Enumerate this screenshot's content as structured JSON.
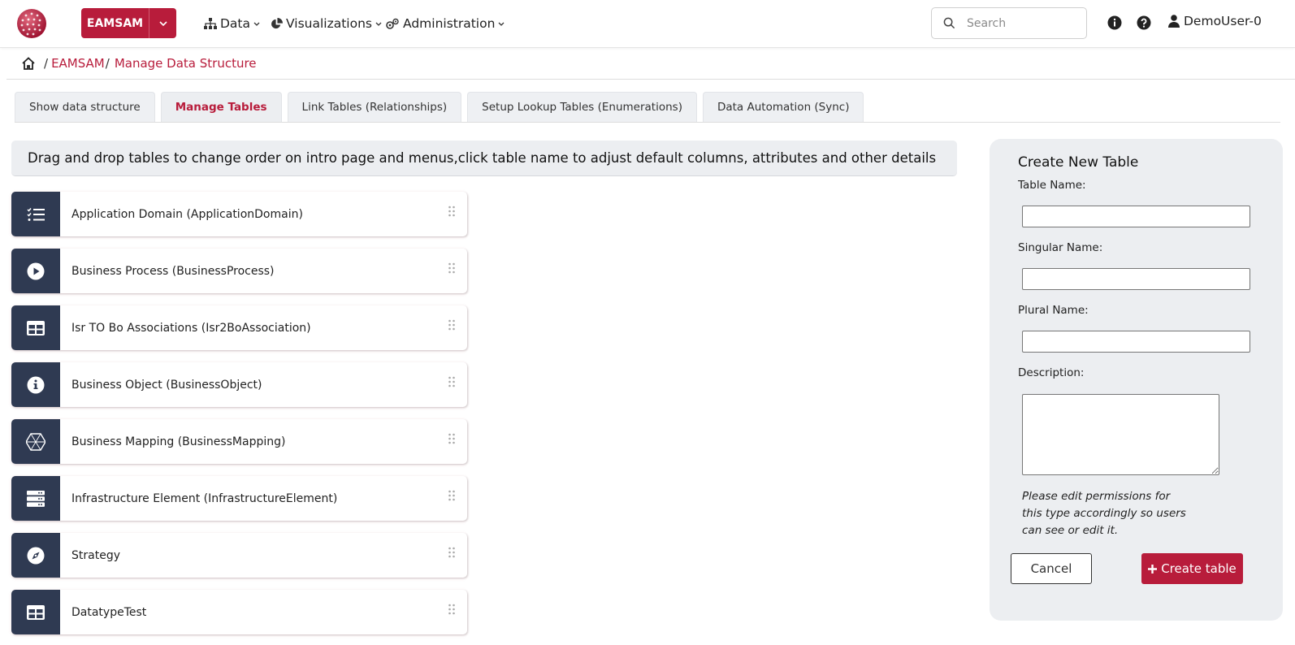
{
  "header": {
    "app_button_label": "EAMSAM",
    "menus": [
      {
        "label": "Data"
      },
      {
        "label": "Visualizations"
      },
      {
        "label": "Administration"
      }
    ],
    "search_placeholder": "Search",
    "user_name": "DemoUser-0"
  },
  "breadcrumb": {
    "items": [
      "EAMSAM",
      "Manage Data Structure"
    ]
  },
  "tabs": [
    {
      "label": "Show data structure",
      "active": false
    },
    {
      "label": "Manage Tables",
      "active": true
    },
    {
      "label": "Link Tables (Relationships)",
      "active": false
    },
    {
      "label": "Setup Lookup Tables (Enumerations)",
      "active": false
    },
    {
      "label": "Data Automation (Sync)",
      "active": false
    }
  ],
  "banner_text": "Drag and drop tables to change order on intro page and menus,click table name to adjust default columns, attributes and other details",
  "tables": [
    {
      "name": "Application Domain (ApplicationDomain)",
      "icon": "checklist-icon"
    },
    {
      "name": "Business Process (BusinessProcess)",
      "icon": "play-circle-icon"
    },
    {
      "name": "Isr TO Bo Associations (Isr2BoAssociation)",
      "icon": "table-grid-icon"
    },
    {
      "name": "Business Object (BusinessObject)",
      "icon": "info-circle-icon"
    },
    {
      "name": "Business Mapping (BusinessMapping)",
      "icon": "hexagon-network-icon"
    },
    {
      "name": "Infrastructure Element (InfrastructureElement)",
      "icon": "server-icon"
    },
    {
      "name": "Strategy",
      "icon": "compass-icon"
    },
    {
      "name": "DatatypeTest",
      "icon": "table-grid-icon"
    }
  ],
  "create_form": {
    "title": "Create New Table",
    "table_name_label": "Table Name:",
    "table_name_value": "",
    "singular_label": "Singular Name:",
    "singular_value": "",
    "plural_label": "Plural Name:",
    "plural_value": "",
    "description_label": "Description:",
    "description_value": "",
    "note": "Please edit permissions for this type accordingly so users can see or edit it.",
    "cancel_label": "Cancel",
    "create_label": "Create table"
  },
  "colors": {
    "brand": "#b81c3b",
    "icon_tile": "#2f3a52",
    "panel_bg": "#eceef1"
  }
}
